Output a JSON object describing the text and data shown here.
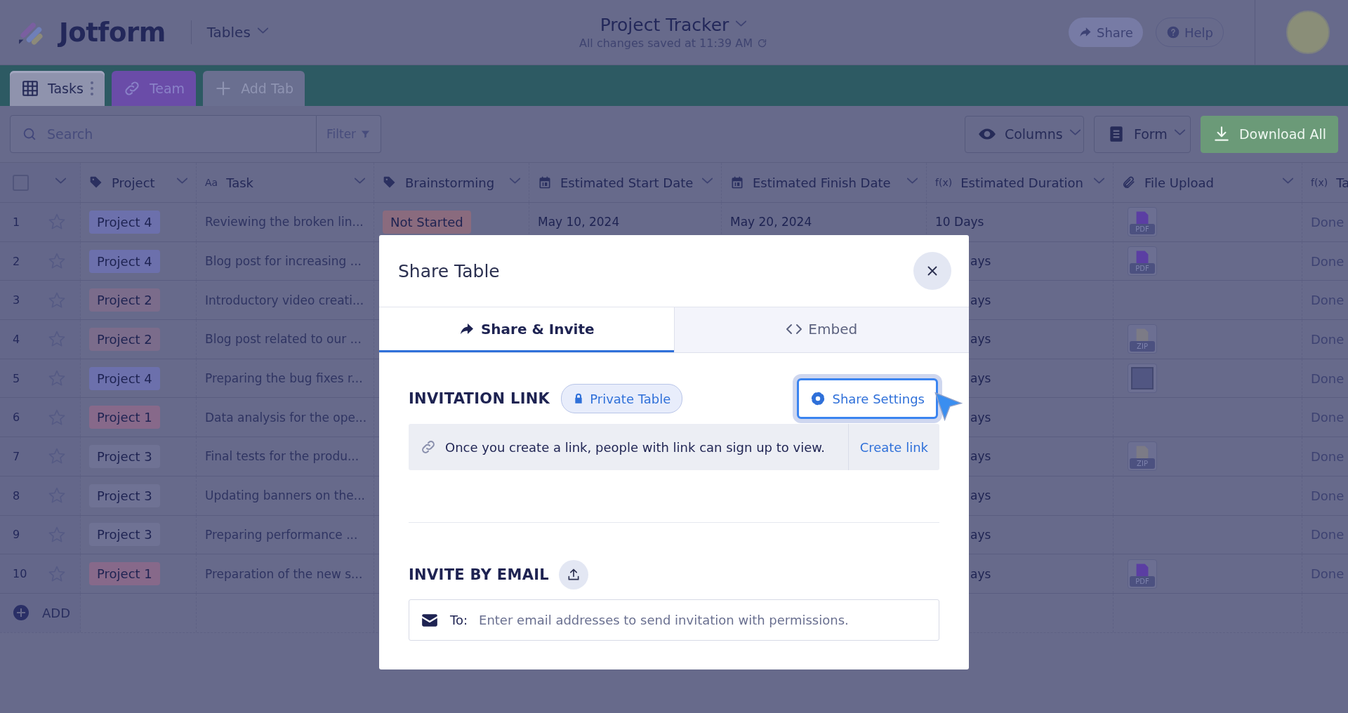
{
  "header": {
    "logo_text": "Jotform",
    "workspace": "Tables",
    "title": "Project Tracker",
    "subtitle": "All changes saved at 11:39 AM",
    "buttons": [
      {
        "kind": "share",
        "label": "Share"
      },
      {
        "kind": "help",
        "label": "Help"
      }
    ]
  },
  "tabs": [
    {
      "kind": "table",
      "label": "Tasks",
      "selected": true
    },
    {
      "kind": "link",
      "label": "Team",
      "selected": false
    }
  ],
  "add_tab": "Add Tab",
  "toolbar": {
    "search": {
      "placeholder": "Search"
    },
    "filter": "Filter",
    "columns": "Columns",
    "form": "Form",
    "download": "Download All"
  },
  "table": {
    "header_checkbox": {
      "checked": false
    },
    "columns": [
      {
        "kind": "tag",
        "label": "Project"
      },
      {
        "kind": "text",
        "glyph": "Aa",
        "label": "Task"
      },
      {
        "kind": "tag",
        "label": "Brainstorming"
      },
      {
        "kind": "date",
        "label": "Estimated Start Date"
      },
      {
        "kind": "date",
        "label": "Estimated Finish Date"
      },
      {
        "kind": "formula",
        "glyph": "f(x)",
        "label": "Estimated Duration"
      },
      {
        "kind": "file",
        "label": "File Upload"
      },
      {
        "kind": "formula",
        "glyph": "f(x)",
        "label": "Ta"
      }
    ],
    "rows": [
      {
        "num": "1",
        "starred": false,
        "project": {
          "label": "Project 4",
          "color": "#6c70ac"
        },
        "task": "Reviewing the broken lin...",
        "status": {
          "label": "Not Started",
          "color": "#8a6b7e"
        },
        "start": "May 10, 2024",
        "finish": "May 20, 2024",
        "duration": "10 Days",
        "file": {
          "kind": "pdf",
          "label": "PDF"
        },
        "last": "Done"
      },
      {
        "num": "2",
        "starred": false,
        "project": {
          "label": "Project 4",
          "color": "#6c70ac"
        },
        "task": "Blog post for increasing ...",
        "duration": "ays",
        "file": {
          "kind": "pdf",
          "label": "PDF"
        },
        "last": "Done"
      },
      {
        "num": "3",
        "starred": false,
        "project": {
          "label": "Project 2",
          "color": "#7b6c8b"
        },
        "task": "Introductory video creati...",
        "duration": "ays",
        "last": "Done"
      },
      {
        "num": "4",
        "starred": false,
        "project": {
          "label": "Project 2",
          "color": "#7b6c8b"
        },
        "task": "Blog post related to our ...",
        "duration": "ays",
        "file": {
          "kind": "zip",
          "label": "ZIP"
        },
        "last": "Done"
      },
      {
        "num": "5",
        "starred": false,
        "project": {
          "label": "Project 4",
          "color": "#6c70ac"
        },
        "task": "Preparing the bug fixes r...",
        "duration": "ays",
        "file": {
          "kind": "image"
        },
        "last": "Done"
      },
      {
        "num": "6",
        "starred": false,
        "project": {
          "label": "Project 1",
          "color": "#87698a"
        },
        "task": "Data analysis for the ope...",
        "duration": "ays",
        "last": "Done"
      },
      {
        "num": "7",
        "starred": false,
        "project": {
          "label": "Project 3",
          "color": "#6f7294"
        },
        "task": "Final tests for the produ...",
        "duration": "ays",
        "file": {
          "kind": "zip",
          "label": "ZIP"
        },
        "last": "Done"
      },
      {
        "num": "8",
        "starred": false,
        "project": {
          "label": "Project 3",
          "color": "#6f7294"
        },
        "task": "Updating banners on the...",
        "duration": "ays",
        "last": "Done"
      },
      {
        "num": "9",
        "starred": false,
        "project": {
          "label": "Project 3",
          "color": "#6f7294"
        },
        "task": "Preparing performance ...",
        "duration": "ays",
        "last": "Done"
      },
      {
        "num": "10",
        "starred": false,
        "project": {
          "label": "Project 1",
          "color": "#87698a"
        },
        "task": "Preparation of the new s...",
        "duration": "ays",
        "file": {
          "kind": "pdf",
          "label": "PDF"
        },
        "last": "Done"
      }
    ],
    "add": "ADD"
  },
  "modal": {
    "title": "Share Table",
    "tabs": [
      {
        "kind": "share",
        "label": "Share & Invite",
        "selected": true
      },
      {
        "kind": "embed",
        "label": "Embed",
        "selected": false
      }
    ],
    "invitation": {
      "heading": "INVITATION LINK",
      "badge": "Private Table",
      "settings_button": "Share Settings",
      "info": "Once you create a link, people with link can sign up to view.",
      "action": "Create link"
    },
    "invite": {
      "heading": "INVITE BY EMAIL",
      "to_label": "To:",
      "placeholder": "Enter email addresses to send invitation with permissions."
    }
  }
}
